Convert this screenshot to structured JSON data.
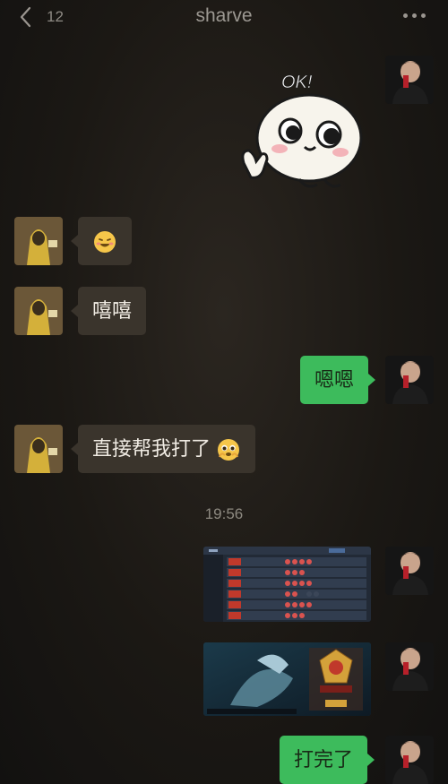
{
  "header": {
    "unread_count": "12",
    "title": "sharve"
  },
  "messages": {
    "m1_sticker_text": "OK!",
    "m3_text": "嘻嘻",
    "m4_text": "嗯嗯",
    "m5_text": "直接帮我打了",
    "timestamp": "19:56",
    "m8_text": "打完了"
  },
  "icons": {
    "back": "chevron-left-icon",
    "more": "more-dots-icon",
    "emoji_grin": "grin-emoji",
    "emoji_pleading": "pleading-emoji"
  },
  "colors": {
    "outgoing_bubble": "#3dbb5c",
    "incoming_bubble": "#3a342c",
    "background": "#1b1814"
  }
}
